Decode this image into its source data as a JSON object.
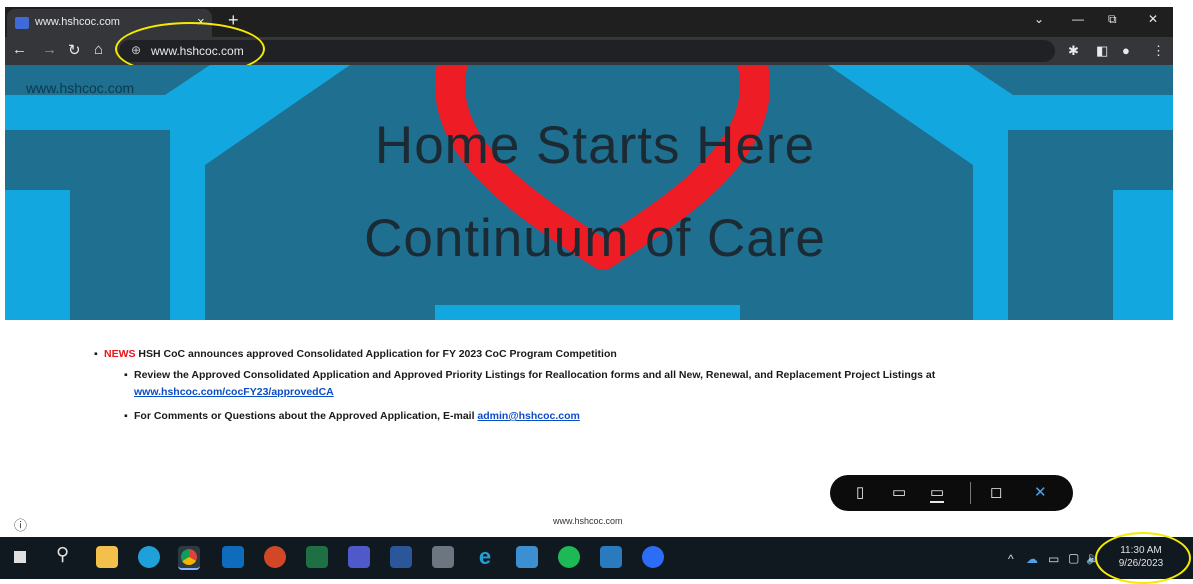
{
  "browser": {
    "tab_title": "www.hshcoc.com",
    "tab_close": "×",
    "new_tab": "+",
    "url": "www.hshcoc.com",
    "win_minimize": "—",
    "win_restore": "⧉",
    "win_close": "✕",
    "chevron": "⌄"
  },
  "page": {
    "site_url_overlay": "www.hshcoc.com",
    "headline_line1": "Home Starts Here",
    "headline_line2": "Continuum of Care",
    "news_tag": "NEWS",
    "news_text": " HSH CoC announces approved Consolidated Application for FY 2023 CoC Program Competition",
    "sub1_text": "Review the Approved Consolidated Application and Approved Priority Listings for Reallocation forms and all New, Renewal, and Replacement Project Listings at",
    "sub1_link": "www.hshcoc.com/cocFY23/approvedCA",
    "sub2_text": "For Comments or Questions about the Approved Application, E-mail ",
    "sub2_link": "admin@hshcoc.com",
    "footer": "www.hshcoc.com",
    "info_icon": "ⓘ"
  },
  "device_toolbar": {
    "close": "✕"
  },
  "taskbar": {
    "time": "11:30 AM",
    "date": "9/26/2023",
    "tray_chevron": "^"
  },
  "colors": {
    "news_red": "#e8151b",
    "heart_red": "#ee1c25",
    "hero_blue": "#1e6f90",
    "house_light_blue": "#13a7e0",
    "annotation_yellow": "#f5ea00"
  }
}
